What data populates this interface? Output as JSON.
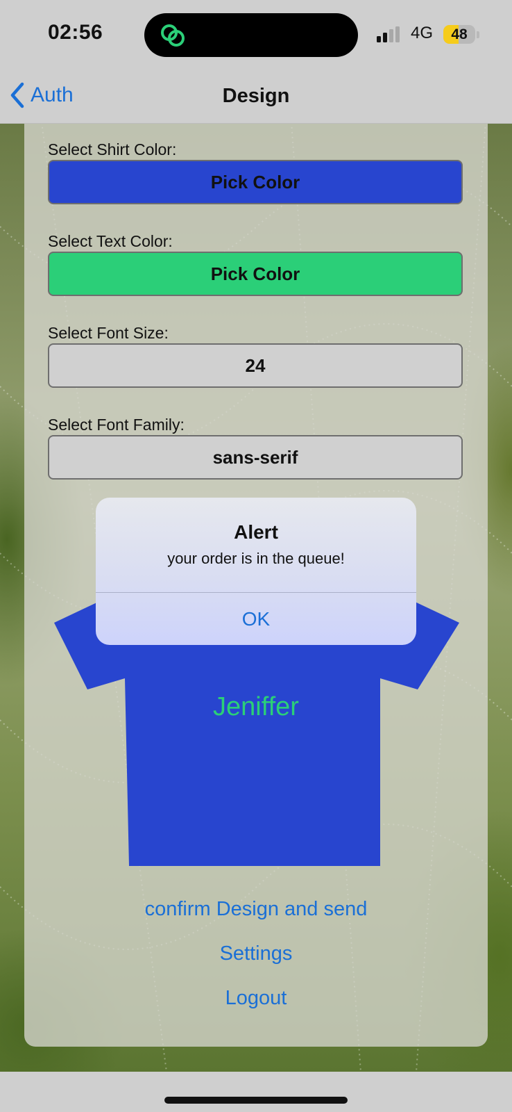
{
  "status_bar": {
    "time": "02:56",
    "network": "4G",
    "battery": "48",
    "battery_level": 0.48
  },
  "nav": {
    "back_label": "Auth",
    "title": "Design"
  },
  "form": {
    "shirt_color_label": "Select Shirt Color:",
    "shirt_color_button": "Pick Color",
    "shirt_color": "#2845cf",
    "text_color_label": "Select Text Color:",
    "text_color_button": "Pick Color",
    "text_color": "#2bcf78",
    "font_size_label": "Select Font Size:",
    "font_size_value": "24",
    "font_family_label": "Select Font Family:",
    "font_family_value": "sans-serif"
  },
  "preview": {
    "shirt_text": "Jeniffer"
  },
  "actions": {
    "confirm": "confirm Design and send",
    "settings": "Settings",
    "logout": "Logout"
  },
  "alert": {
    "title": "Alert",
    "message": "your order is in the queue!",
    "ok_label": "OK"
  },
  "colors": {
    "accent": "#1a6fd6",
    "shirt": "#2845cf",
    "text": "#2bcf78",
    "button_gray": "#d0d0d0"
  }
}
